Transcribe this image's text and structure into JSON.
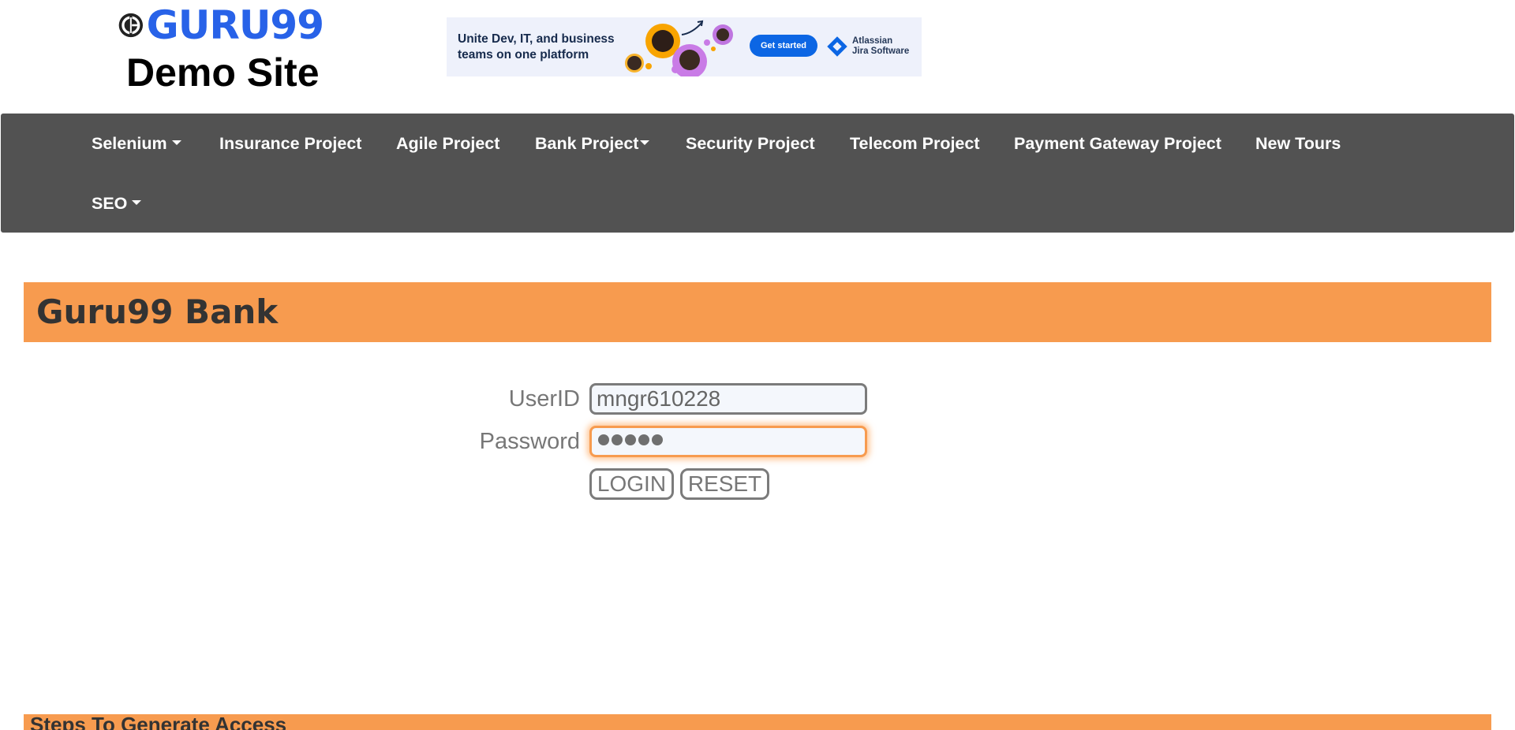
{
  "header": {
    "logo_text": "GURU99",
    "subtitle": "Demo Site"
  },
  "ad": {
    "headline": "Unite Dev, IT, and business teams on one platform",
    "button_label": "Get started",
    "brand_line1": "Atlassian",
    "brand_line2": "Jira Software",
    "accent_color": "#0c66e4"
  },
  "nav": {
    "items": [
      {
        "label": "Selenium",
        "dropdown": true
      },
      {
        "label": "Insurance Project",
        "dropdown": false
      },
      {
        "label": "Agile Project",
        "dropdown": false
      },
      {
        "label": "Bank Project",
        "dropdown": true
      },
      {
        "label": "Security Project",
        "dropdown": false
      },
      {
        "label": "Telecom Project",
        "dropdown": false
      },
      {
        "label": "Payment Gateway Project",
        "dropdown": false
      },
      {
        "label": "New Tours",
        "dropdown": false
      },
      {
        "label": "SEO",
        "dropdown": true
      }
    ],
    "background": "#525252"
  },
  "bank": {
    "title": "Guru99 Bank",
    "bar_color": "#f79b4f"
  },
  "form": {
    "userid_label": "UserID",
    "userid_value": "mngr610228",
    "password_label": "Password",
    "password_masked_length": 5,
    "login_label": "LOGIN",
    "reset_label": "RESET"
  },
  "footer": {
    "heading": "Steps To Generate Access"
  }
}
